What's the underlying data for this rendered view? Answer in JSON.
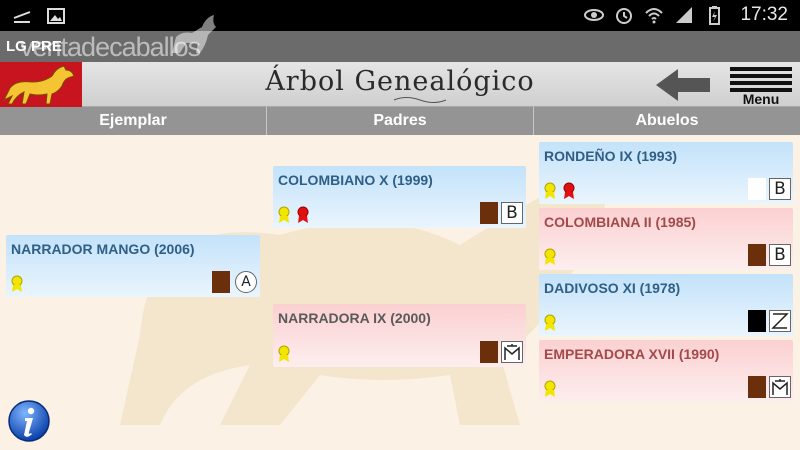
{
  "statusbar": {
    "time": "17:32",
    "icons": [
      "usb-debug-icon",
      "image-icon",
      "eye-icon",
      "alarm-icon",
      "wifi-icon",
      "signal-icon",
      "battery-charging-icon"
    ]
  },
  "app": {
    "title": "LG PRE",
    "watermark": "ventadecaballos"
  },
  "header": {
    "title": "Árbol Genealógico",
    "menu_label": "Menu"
  },
  "columns": [
    "Ejemplar",
    "Padres",
    "Abuelos"
  ],
  "colors": {
    "logo_bg": "#c8141e",
    "male_card": "#c3e2fa",
    "female_card": "#fbd0d1",
    "coat_bay": "#6b2f0c",
    "coat_black": "#000000",
    "coat_white": "#ffffff"
  },
  "horses": {
    "ejemplar": {
      "name": "NARRADOR MANGO (2006)",
      "sex": "male",
      "medals": [
        "yellow"
      ],
      "coat": "bay",
      "brand": "A"
    },
    "padre": {
      "name": "COLOMBIANO X (1999)",
      "sex": "male",
      "medals": [
        "yellow",
        "red"
      ],
      "coat": "bay",
      "brand": "B"
    },
    "madre": {
      "name": "NARRADORA IX (2000)",
      "sex": "female",
      "medals": [
        "yellow"
      ],
      "coat": "bay",
      "brand": "M-tower"
    },
    "abuelo_pp": {
      "name": "RONDEÑO IX (1993)",
      "sex": "male",
      "medals": [
        "yellow",
        "red"
      ],
      "coat": "white",
      "brand": "B"
    },
    "abuela_pp": {
      "name": "COLOMBIANA II (1985)",
      "sex": "female",
      "medals": [
        "yellow"
      ],
      "coat": "bay",
      "brand": "B"
    },
    "abuelo_mp": {
      "name": "DADIVOSO XI (1978)",
      "sex": "male",
      "medals": [
        "yellow"
      ],
      "coat": "black",
      "brand": "Z"
    },
    "abuela_mp": {
      "name": "EMPERADORA XVII (1990)",
      "sex": "female",
      "medals": [
        "yellow"
      ],
      "coat": "bay",
      "brand": "M-tower"
    }
  }
}
